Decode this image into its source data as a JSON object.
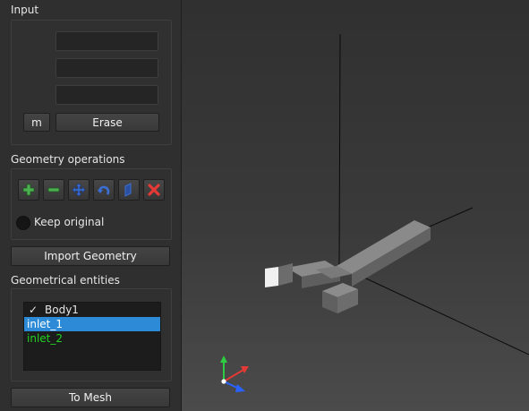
{
  "input": {
    "section_label": "Input",
    "fields": [
      {
        "value": "",
        "placeholder": ""
      },
      {
        "value": "",
        "placeholder": ""
      },
      {
        "value": "",
        "placeholder": ""
      }
    ],
    "unit_button": "m",
    "erase_button": "Erase"
  },
  "geometry_operations": {
    "section_label": "Geometry operations",
    "tools": [
      {
        "icon": "plus-icon",
        "color": "#4caf50"
      },
      {
        "icon": "minus-icon",
        "color": "#4caf50"
      },
      {
        "icon": "move-icon",
        "color": "#3b6fd6"
      },
      {
        "icon": "rotate-icon",
        "color": "#3b6fd6"
      },
      {
        "icon": "scale-icon",
        "color": "#3b6fd6"
      },
      {
        "icon": "delete-icon",
        "color": "#e53935"
      }
    ],
    "keep_original_label": "Keep original",
    "keep_original_checked": false
  },
  "import_geometry_button": "Import Geometry",
  "geometrical_entities": {
    "section_label": "Geometrical entities",
    "items": [
      {
        "label": "Body1",
        "checked": true,
        "selected": false,
        "color": "#e6e6e6"
      },
      {
        "label": "inlet_1",
        "checked": false,
        "selected": true,
        "color": "#ffffff"
      },
      {
        "label": "inlet_2",
        "checked": false,
        "selected": false,
        "color": "#22d322"
      }
    ]
  },
  "to_mesh_button": "To Mesh",
  "viewport": {
    "background_top": "#303030",
    "background_bottom": "#4b4b4b",
    "axis_colors": {
      "x": "#e53935",
      "y": "#2ecc40",
      "z": "#2962ff"
    }
  }
}
